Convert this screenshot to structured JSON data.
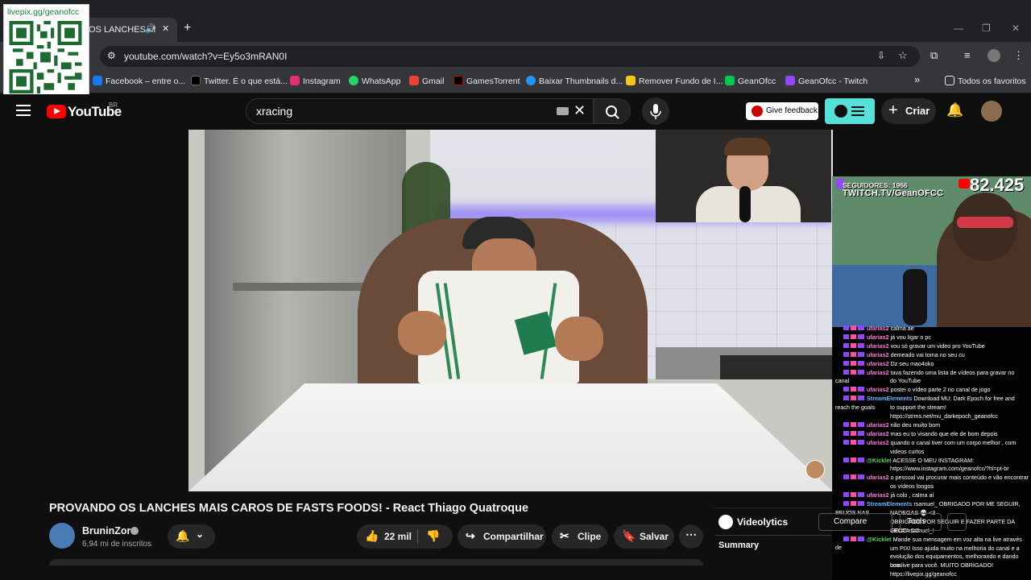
{
  "qr": {
    "label": "livepix.gg/geanofcc"
  },
  "browser": {
    "tab_title": "OS LANCHES M",
    "tab_icons": [
      "speaker-icon",
      "close-icon"
    ],
    "new_tab": "+",
    "window_controls": [
      "—",
      "❐",
      "✕"
    ],
    "url": "youtube.com/watch?v=Ey5o3mRAN0I",
    "bookmarks": [
      {
        "label": "Facebook – entre o...",
        "color": "#1877f2"
      },
      {
        "label": "Twitter. É o que está...",
        "color": "#000000"
      },
      {
        "label": "Instagram",
        "color": "#e1306c"
      },
      {
        "label": "WhatsApp",
        "color": "#25d366"
      },
      {
        "label": "Gmail",
        "color": "#ea4335"
      },
      {
        "label": "GamesTorrent",
        "color": "#000000"
      },
      {
        "label": "Baixar Thumbnails d...",
        "color": "#2196f3"
      },
      {
        "label": "Remover Fundo de I...",
        "color": "#f5c518"
      },
      {
        "label": "GeanOfcc",
        "color": "#00c853"
      },
      {
        "label": "GeanOfcc - Twitch",
        "color": "#9146ff"
      }
    ],
    "overflow": "»",
    "all_favorites": "Todos os favoritos"
  },
  "youtube": {
    "logo_text": "YouTube",
    "region": "BR",
    "search_value": "xracing",
    "feedback": "Give feedback",
    "create": "Criar"
  },
  "video": {
    "title": "PROVANDO OS LANCHES MAIS CAROS DE FASTS FOODS! - React Thiago Quatroque",
    "channel": "BruninZor",
    "subscribers": "6,94 mi de inscritos",
    "likes": "22 mil",
    "share": "Compartilhar",
    "clip": "Clipe",
    "save": "Salvar"
  },
  "overlay": {
    "followers": "SEGUIDORES: 1966",
    "twitch_url": "TWITCH.TV/GeanOFCC",
    "sub_count": "82.425"
  },
  "chat": [
    {
      "user": "ufarias2",
      "text": "calma ae",
      "type": "user"
    },
    {
      "user": "ufarias2",
      "text": "já vou ligar o pc",
      "type": "user"
    },
    {
      "user": "ufarias2",
      "text": "vou só gravar um video pro YouTube",
      "type": "user"
    },
    {
      "user": "ufarias2",
      "text": "demeado vai toma no seu cu",
      "type": "user"
    },
    {
      "user": "ufarias2",
      "text": "Dz seu mao4oko",
      "type": "user"
    },
    {
      "user": "ufarias2",
      "text": "tava fazendo uma lista de vídeos para gravar no canal",
      "type": "user"
    },
    {
      "user": "",
      "text": "do YouTube",
      "type": "cont"
    },
    {
      "user": "ufarias2",
      "text": "postei o vídeo parte 2 no canal de jogo",
      "type": "user"
    },
    {
      "user": "StreamElements",
      "text": "Download MU: Dark Epoch for free and reach the goals",
      "type": "se"
    },
    {
      "user": "",
      "text": "to support the stream!",
      "type": "cont"
    },
    {
      "user": "",
      "text": "https://strms.net/mu_darkepoch_geanofcc",
      "type": "cont"
    },
    {
      "user": "ufarias2",
      "text": "não deu muito bom",
      "type": "user"
    },
    {
      "user": "ufarias2",
      "text": "mas eu to visando que ele de bom depois",
      "type": "user"
    },
    {
      "user": "ufarias2",
      "text": "quando o canal tiver com um corpo melhor , com",
      "type": "user"
    },
    {
      "user": "",
      "text": "videos curtos",
      "type": "cont"
    },
    {
      "user": "@Kicklet",
      "text": "ACESSE O MEU INSTAGRAM:",
      "type": "kb"
    },
    {
      "user": "",
      "text": "https://www.instagram.com/geanofcc/?hl=pt-br",
      "type": "cont"
    },
    {
      "user": "ufarias2",
      "text": "o pessoal vai procurar mais conteúdo e vão encontrar",
      "type": "user"
    },
    {
      "user": "",
      "text": "os vídeos longos",
      "type": "cont"
    },
    {
      "user": "ufarias2",
      "text": "já colo , calma aí",
      "type": "user"
    },
    {
      "user": "StreamElements",
      "text": "rsamuel_ OBRIGADO POR ME SEGUIR, BEIJOS NAS",
      "type": "se"
    },
    {
      "user": "",
      "text": "NADEGAS 💀 <3",
      "type": "cont"
    },
    {
      "user": "",
      "text": "OBRIGADO POR SEGUIR E FAZER PARTE DA TROPA DO",
      "type": "cont"
    },
    {
      "user": "",
      "text": "GEOC rsamuel_!",
      "type": "cont"
    },
    {
      "user": "@Kicklet",
      "text": "Mande sua mensagem em voz alta na live através de",
      "type": "kb"
    },
    {
      "user": "",
      "text": "um PIX! Isso ajuda muito na melhoria do canal e a",
      "type": "cont"
    },
    {
      "user": "",
      "text": "evolução dos equipamentos, melhorando e dando uma",
      "type": "cont"
    },
    {
      "user": "",
      "text": "boa live para você. MUITO OBRIGADO!",
      "type": "cont"
    },
    {
      "user": "",
      "text": "https://livepix.gg/geanofcc",
      "type": "cont"
    }
  ],
  "videolytics": {
    "name": "Videolytics",
    "compare": "Compare",
    "tools": "Tools",
    "summary": "Summary"
  },
  "colors": {
    "yt_red": "#ff0000",
    "twitch_purple": "#9146ff",
    "videolytics_teal": "#55e0d8"
  }
}
